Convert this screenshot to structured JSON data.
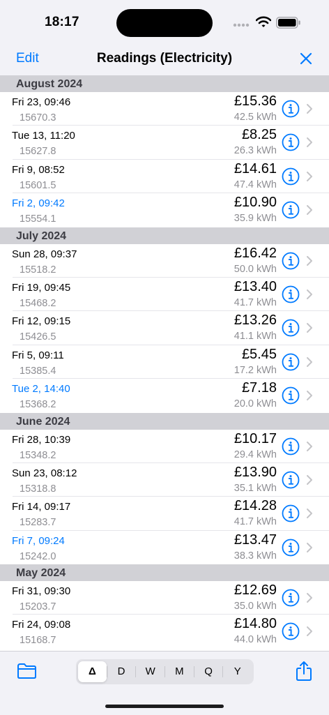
{
  "status_bar": {
    "time": "18:17"
  },
  "nav": {
    "edit_label": "Edit",
    "title": "Readings (Electricity)"
  },
  "colors": {
    "accent": "#007aff",
    "section_bg": "#d1d1d6",
    "secondary_text": "#8e8e93"
  },
  "sections": [
    {
      "title": "August 2024",
      "rows": [
        {
          "date": "Fri 23, 09:46",
          "reading": "15670.3",
          "cost": "£15.36",
          "usage": "42.5 kWh",
          "highlight": false
        },
        {
          "date": "Tue 13, 11:20",
          "reading": "15627.8",
          "cost": "£8.25",
          "usage": "26.3 kWh",
          "highlight": false
        },
        {
          "date": "Fri 9, 08:52",
          "reading": "15601.5",
          "cost": "£14.61",
          "usage": "47.4 kWh",
          "highlight": false
        },
        {
          "date": "Fri 2, 09:42",
          "reading": "15554.1",
          "cost": "£10.90",
          "usage": "35.9 kWh",
          "highlight": true
        }
      ]
    },
    {
      "title": "July 2024",
      "rows": [
        {
          "date": "Sun 28, 09:37",
          "reading": "15518.2",
          "cost": "£16.42",
          "usage": "50.0 kWh",
          "highlight": false
        },
        {
          "date": "Fri 19, 09:45",
          "reading": "15468.2",
          "cost": "£13.40",
          "usage": "41.7 kWh",
          "highlight": false
        },
        {
          "date": "Fri 12, 09:15",
          "reading": "15426.5",
          "cost": "£13.26",
          "usage": "41.1 kWh",
          "highlight": false
        },
        {
          "date": "Fri 5, 09:11",
          "reading": "15385.4",
          "cost": "£5.45",
          "usage": "17.2 kWh",
          "highlight": false
        },
        {
          "date": "Tue 2, 14:40",
          "reading": "15368.2",
          "cost": "£7.18",
          "usage": "20.0 kWh",
          "highlight": true
        }
      ]
    },
    {
      "title": "June 2024",
      "rows": [
        {
          "date": "Fri 28, 10:39",
          "reading": "15348.2",
          "cost": "£10.17",
          "usage": "29.4 kWh",
          "highlight": false
        },
        {
          "date": "Sun 23, 08:12",
          "reading": "15318.8",
          "cost": "£13.90",
          "usage": "35.1 kWh",
          "highlight": false
        },
        {
          "date": "Fri 14, 09:17",
          "reading": "15283.7",
          "cost": "£14.28",
          "usage": "41.7 kWh",
          "highlight": false
        },
        {
          "date": "Fri 7, 09:24",
          "reading": "15242.0",
          "cost": "£13.47",
          "usage": "38.3 kWh",
          "highlight": true
        }
      ]
    },
    {
      "title": "May 2024",
      "rows": [
        {
          "date": "Fri 31, 09:30",
          "reading": "15203.7",
          "cost": "£12.69",
          "usage": "35.0 kWh",
          "highlight": false
        },
        {
          "date": "Fri 24, 09:08",
          "reading": "15168.7",
          "cost": "£14.80",
          "usage": "44.0 kWh",
          "highlight": false
        }
      ]
    }
  ],
  "toolbar": {
    "segments": [
      "Δ",
      "D",
      "W",
      "M",
      "Q",
      "Y"
    ],
    "selected_segment": "Δ"
  }
}
